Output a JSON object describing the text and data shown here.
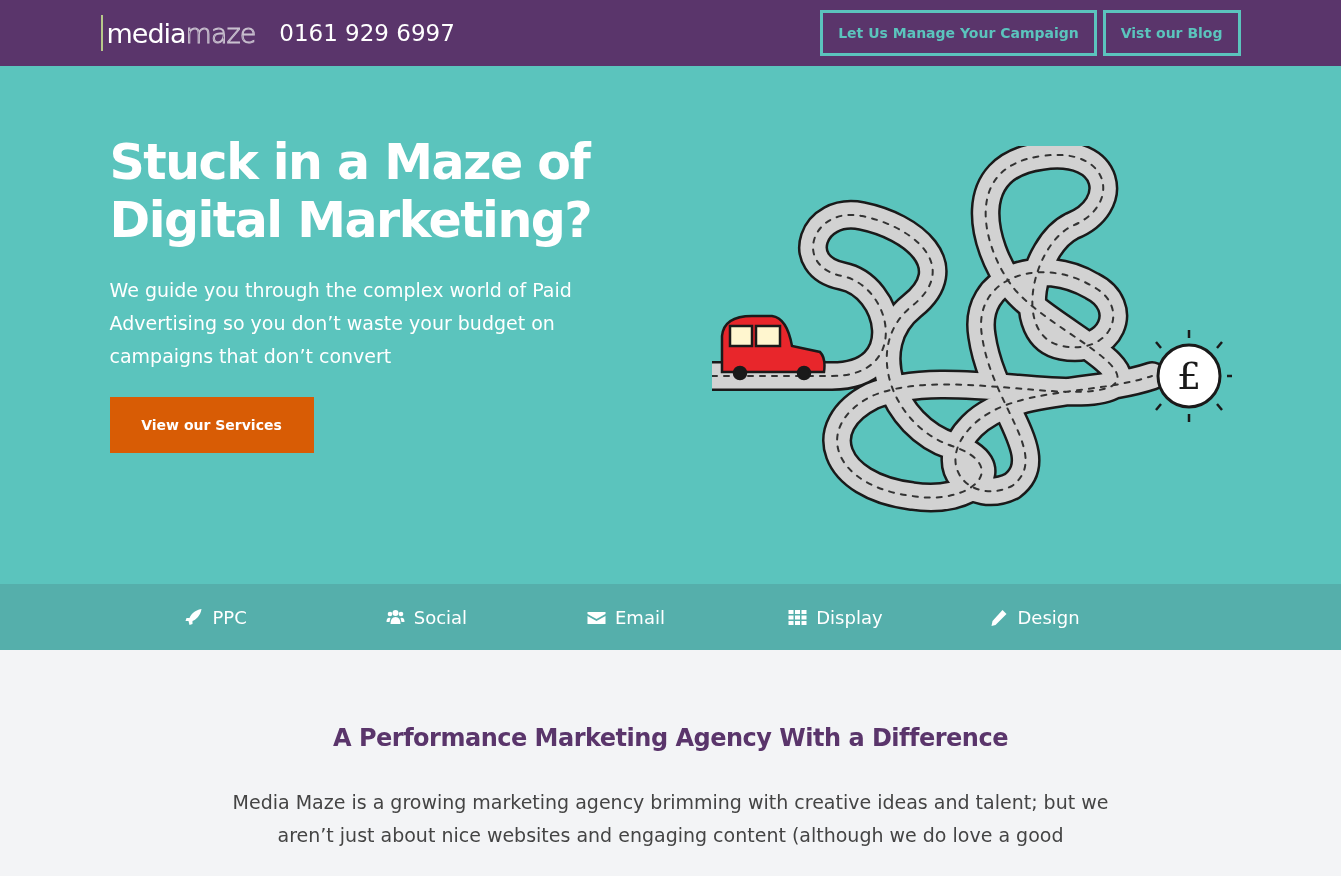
{
  "header": {
    "logo": {
      "first": "media",
      "second": "maze"
    },
    "phone": "0161 929 6997",
    "buttons": [
      "Let Us Manage Your Campaign",
      "Vist our Blog"
    ]
  },
  "hero": {
    "title_lines": [
      "Stuck in a Maze of",
      "Digital Marketing?"
    ],
    "text": "We guide you through the complex world of Paid Advertising so you don’t waste your budget on campaigns that don’t convert",
    "button": "View our Services",
    "coin_symbol": "£"
  },
  "services": [
    {
      "kind": "rocket",
      "label": "PPC"
    },
    {
      "kind": "users",
      "label": "Social"
    },
    {
      "kind": "envelope",
      "label": "Email"
    },
    {
      "kind": "grid",
      "label": "Display"
    },
    {
      "kind": "pencil",
      "label": "Design"
    }
  ],
  "intro": {
    "heading": "A Performance Marketing Agency With a Difference",
    "text": "Media Maze is a growing marketing agency brimming with creative ideas and talent; but we aren’t just about nice websites and engaging content (although we do love a good"
  }
}
